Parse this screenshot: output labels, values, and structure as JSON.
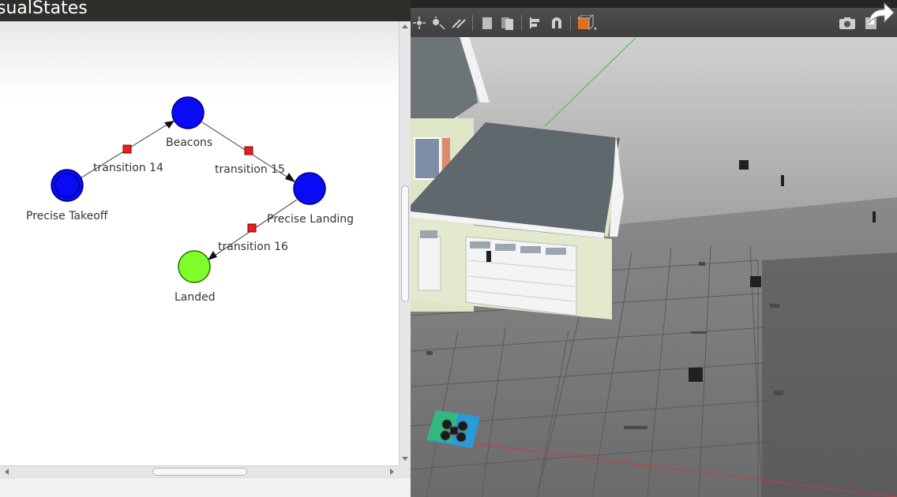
{
  "window": {
    "title": "sualStates"
  },
  "state_machine": {
    "states": [
      {
        "id": "precise_takeoff",
        "label": "Precise Takeoff",
        "color": "#0a0af5"
      },
      {
        "id": "beacons",
        "label": "Beacons",
        "color": "#0a0af5"
      },
      {
        "id": "precise_landing",
        "label": "Precise Landing",
        "color": "#0a0af5"
      },
      {
        "id": "landed",
        "label": "Landed",
        "color": "#7fff2a"
      }
    ],
    "transitions": [
      {
        "label": "transition 14",
        "from": "precise_takeoff",
        "to": "beacons"
      },
      {
        "label": "transition 15",
        "from": "beacons",
        "to": "precise_landing"
      },
      {
        "label": "transition 16",
        "from": "precise_landing",
        "to": "landed"
      }
    ],
    "transition_marker_color": "#e82020"
  },
  "simulator": {
    "toolbar_icons": [
      "translate-icon",
      "light-icon",
      "align-icon",
      "copy-icon",
      "paste-icon",
      "snap-icon",
      "magnet-icon",
      "box-color-icon",
      "camera-icon",
      "record-icon"
    ],
    "share_icon": "share-arrow-icon"
  }
}
